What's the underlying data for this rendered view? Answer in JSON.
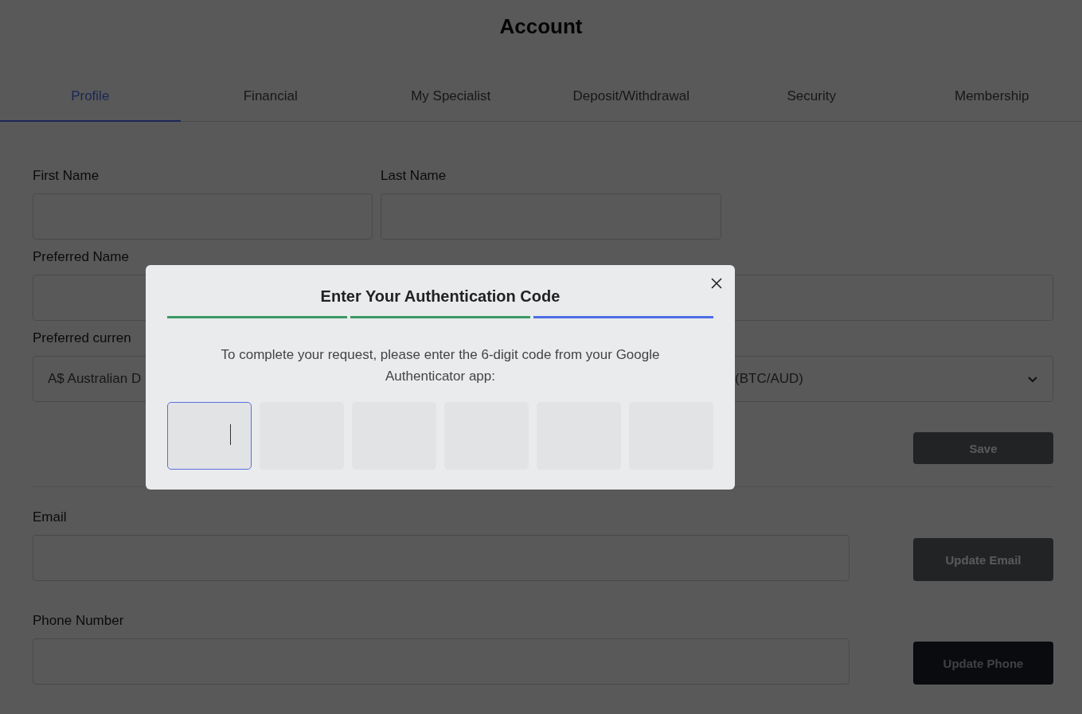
{
  "page": {
    "title": "Account"
  },
  "tabs": [
    {
      "label": "Profile",
      "selected": true
    },
    {
      "label": "Financial",
      "selected": false
    },
    {
      "label": "My Specialist",
      "selected": false
    },
    {
      "label": "Deposit/Withdrawal",
      "selected": false
    },
    {
      "label": "Security",
      "selected": false
    },
    {
      "label": "Membership",
      "selected": false
    }
  ],
  "profile_form": {
    "first_name_label": "First Name",
    "last_name_label": "Last Name",
    "preferred_name_label": "Preferred Name",
    "preferred_currency_label": "Preferred curren",
    "preferred_currency_value": "A$ Australian D",
    "pair_value": "(BTC/AUD)",
    "save_button": {
      "label": "Save",
      "disabled": true
    }
  },
  "email": {
    "label": "Email",
    "button": {
      "label": "Update Email",
      "disabled": true
    }
  },
  "phone": {
    "label": "Phone Number",
    "button": {
      "label": "Update Phone",
      "disabled": false
    }
  },
  "modal": {
    "title": "Enter Your Authentication Code",
    "steps": [
      {
        "complete": true
      },
      {
        "complete": true
      },
      {
        "complete": false
      }
    ],
    "message": "To complete your request, please enter the 6-digit code from your Google Authenticator app:",
    "code_boxes": [
      {
        "selected": true
      },
      {
        "selected": false
      },
      {
        "selected": false
      },
      {
        "selected": false
      },
      {
        "selected": false
      },
      {
        "selected": false
      }
    ]
  }
}
